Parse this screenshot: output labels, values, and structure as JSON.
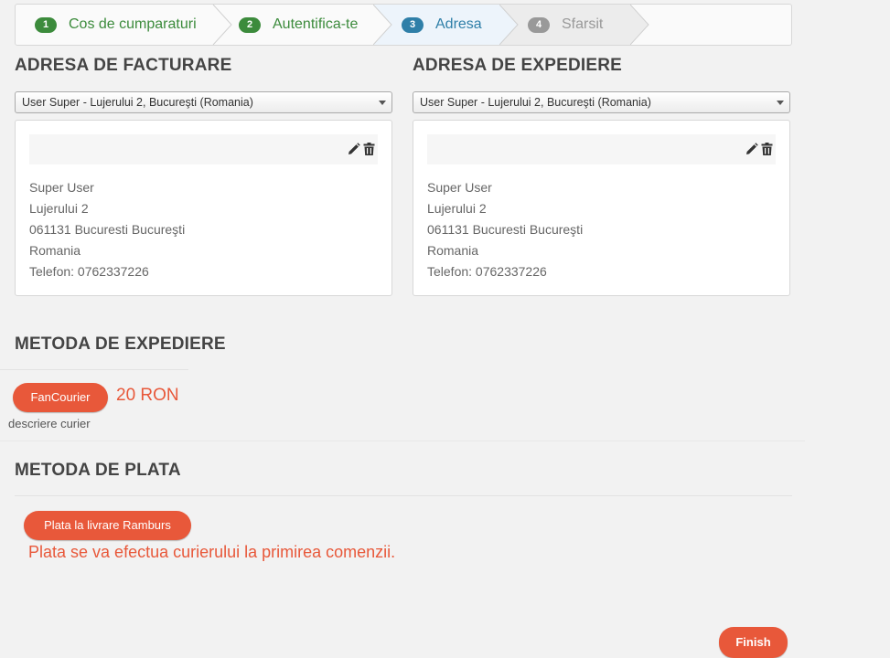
{
  "steps": [
    {
      "number": "1",
      "label": "Cos de cumparaturi"
    },
    {
      "number": "2",
      "label": "Autentifica-te"
    },
    {
      "number": "3",
      "label": "Adresa"
    },
    {
      "number": "4",
      "label": "Sfarsit"
    }
  ],
  "billing": {
    "title": "ADRESA DE FACTURARE",
    "selected": "User Super - Lujerului 2, Bucureşti (Romania)",
    "lines": [
      "Super User",
      "Lujerului 2",
      "061131 Bucuresti Bucureşti",
      "Romania",
      "Telefon: 0762337226"
    ]
  },
  "shipping": {
    "title": "ADRESA DE EXPEDIERE",
    "selected": "User Super - Lujerului 2, Bucureşti (Romania)",
    "lines": [
      "Super User",
      "Lujerului 2",
      "061131 Bucuresti Bucureşti",
      "Romania",
      "Telefon: 0762337226"
    ]
  },
  "delivery": {
    "title": "METODA DE EXPEDIERE",
    "option": "FanCourier",
    "price": "20 RON",
    "description": "descriere curier"
  },
  "payment": {
    "title": "METODA DE PLATA",
    "option": "Plata la livrare Ramburs",
    "note": "Plata se va efectua curierului la primirea comenzii."
  },
  "finish_label": "Finish",
  "colors": {
    "accent": "#e8583a",
    "done": "#3c8b3c",
    "active": "#2f7fa8",
    "future": "#999999"
  }
}
